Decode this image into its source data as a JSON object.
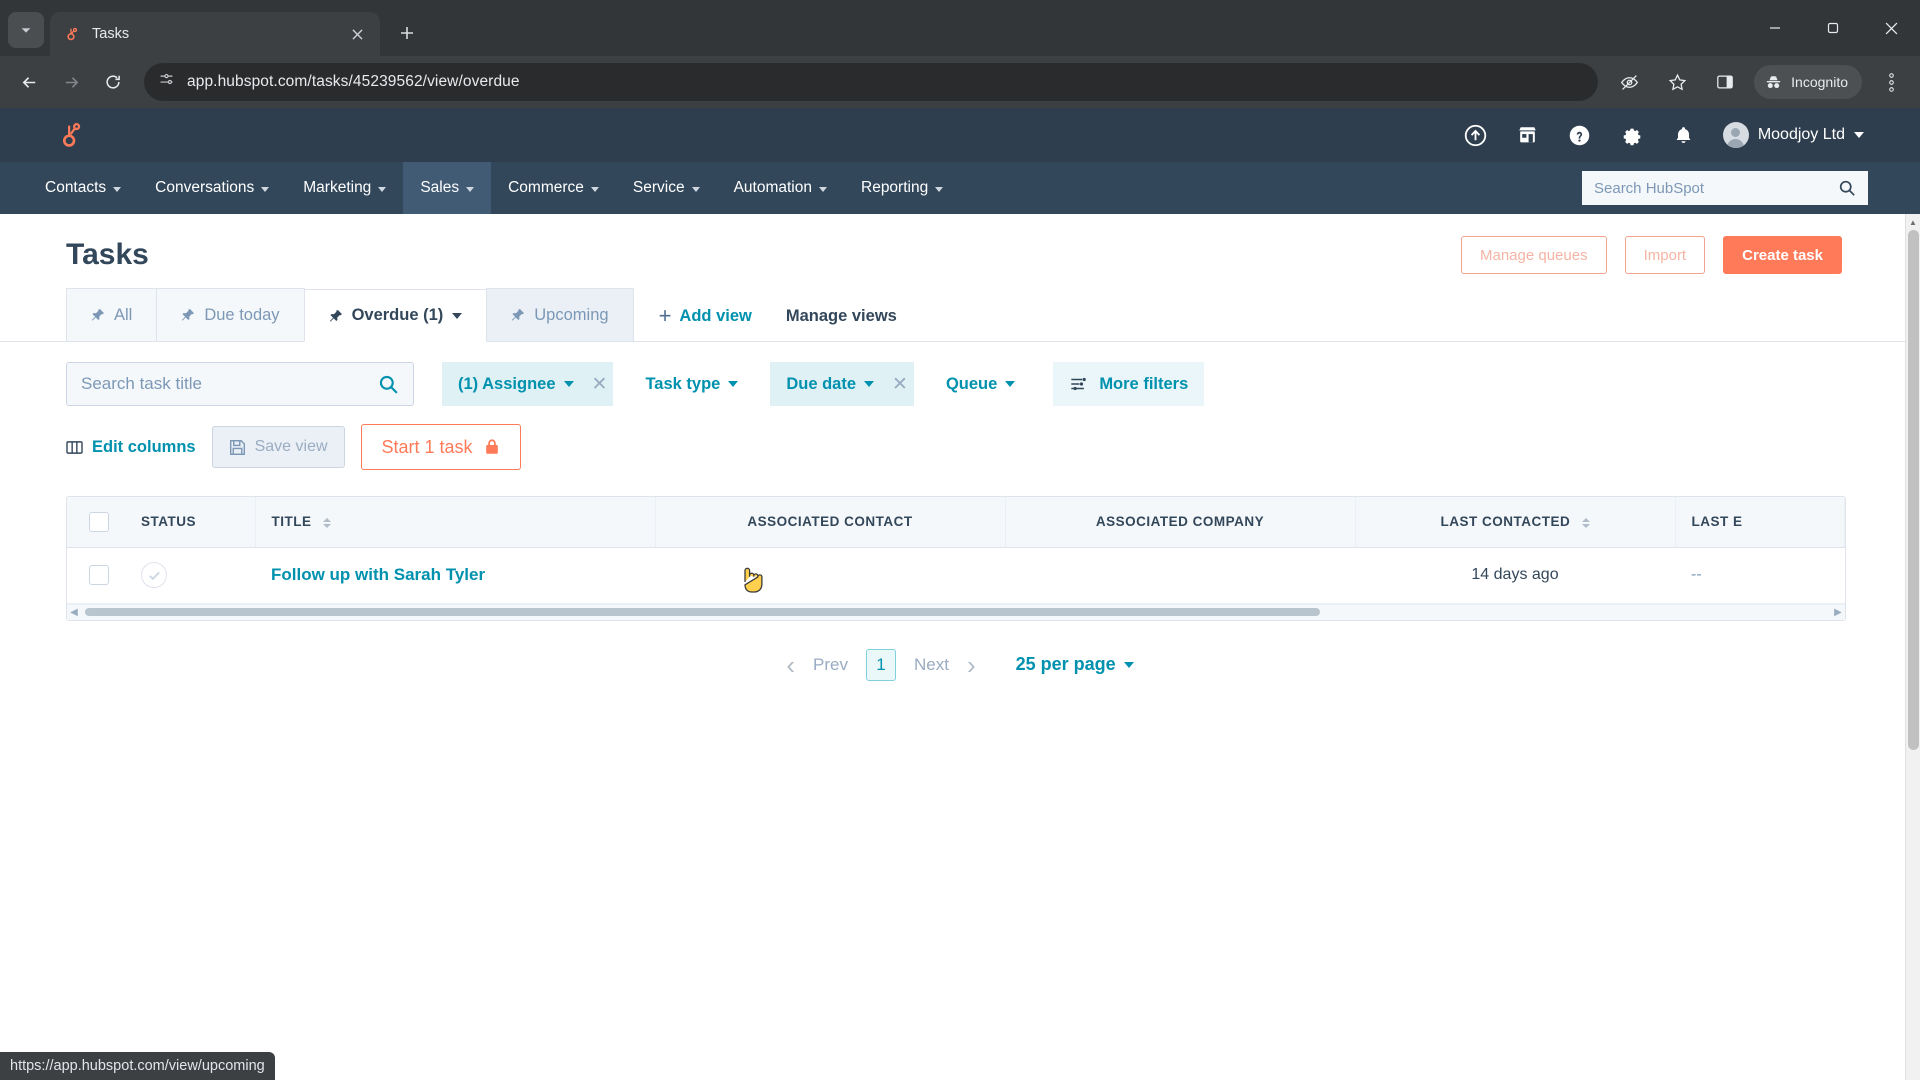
{
  "browser": {
    "tab": {
      "title": "Tasks",
      "favicon": "hubspot-sprocket-icon"
    },
    "url": "app.hubspot.com/tasks/45239562/view/overdue",
    "profile_label": "Incognito",
    "status_link": "https://app.hubspot.com/view/upcoming",
    "icons": {
      "tab_search": "chevron-down-icon",
      "new_tab": "plus-icon",
      "close_tab": "close-icon",
      "back": "back-arrow-icon",
      "forward": "forward-arrow-icon",
      "reload": "reload-icon",
      "site_info": "page-settings-icon",
      "tracking": "eye-off-icon",
      "bookmark": "star-icon",
      "side_panel": "side-panel-icon",
      "incognito": "incognito-hat-icon",
      "menu": "three-dot-menu-icon",
      "minimize": "minimize-icon",
      "maximize": "maximize-icon",
      "close_window": "window-close-icon"
    }
  },
  "hubspot": {
    "logo": "hubspot-sprocket-icon",
    "top_icons": [
      {
        "name": "upgrade-icon",
        "glyph": "arrow-up-circle"
      },
      {
        "name": "marketplace-icon",
        "glyph": "store"
      },
      {
        "name": "help-icon",
        "glyph": "question-circle"
      },
      {
        "name": "settings-icon",
        "glyph": "gear"
      },
      {
        "name": "notifications-icon",
        "glyph": "bell"
      }
    ],
    "account_name": "Moodjoy Ltd",
    "nav": [
      {
        "label": "Contacts",
        "active": false
      },
      {
        "label": "Conversations",
        "active": false
      },
      {
        "label": "Marketing",
        "active": false
      },
      {
        "label": "Sales",
        "active": true
      },
      {
        "label": "Commerce",
        "active": false
      },
      {
        "label": "Service",
        "active": false
      },
      {
        "label": "Automation",
        "active": false
      },
      {
        "label": "Reporting",
        "active": false
      }
    ],
    "search_placeholder": "Search HubSpot"
  },
  "page": {
    "title": "Tasks",
    "actions": {
      "manage_queues": "Manage queues",
      "import": "Import",
      "create_task": "Create task"
    },
    "views": [
      {
        "label": "All",
        "active": false,
        "hover": false,
        "caret": false
      },
      {
        "label": "Due today",
        "active": false,
        "hover": false,
        "caret": false
      },
      {
        "label": "Overdue (1)",
        "active": true,
        "hover": false,
        "caret": true
      },
      {
        "label": "Upcoming",
        "active": false,
        "hover": true,
        "caret": false
      }
    ],
    "add_view": "Add view",
    "manage_views": "Manage views",
    "search": {
      "placeholder": "Search task title",
      "value": ""
    },
    "filters": [
      {
        "label": "(1) Assignee",
        "selected": true,
        "clearable": true
      },
      {
        "label": "Task type",
        "selected": false,
        "clearable": false
      },
      {
        "label": "Due date",
        "selected": true,
        "clearable": true
      },
      {
        "label": "Queue",
        "selected": false,
        "clearable": false
      }
    ],
    "more_filters": "More filters",
    "edit_columns": "Edit columns",
    "save_view": "Save view",
    "start_task": "Start 1 task",
    "start_task_lock": "lock-icon",
    "table": {
      "columns": [
        {
          "label": "STATUS",
          "sortable": false
        },
        {
          "label": "TITLE",
          "sortable": true
        },
        {
          "label": "ASSOCIATED CONTACT",
          "sortable": false
        },
        {
          "label": "ASSOCIATED COMPANY",
          "sortable": false
        },
        {
          "label": "LAST CONTACTED",
          "sortable": true
        },
        {
          "label": "LAST E",
          "sortable": false
        }
      ],
      "rows": [
        {
          "status": "incomplete-check-icon",
          "title": "Follow up with Sarah Tyler",
          "associated_contact": "",
          "associated_company": "",
          "last_contacted": "14 days ago",
          "last_e": "--"
        }
      ]
    },
    "pagination": {
      "prev": "Prev",
      "page": "1",
      "next": "Next",
      "per_page": "25 per page"
    }
  }
}
